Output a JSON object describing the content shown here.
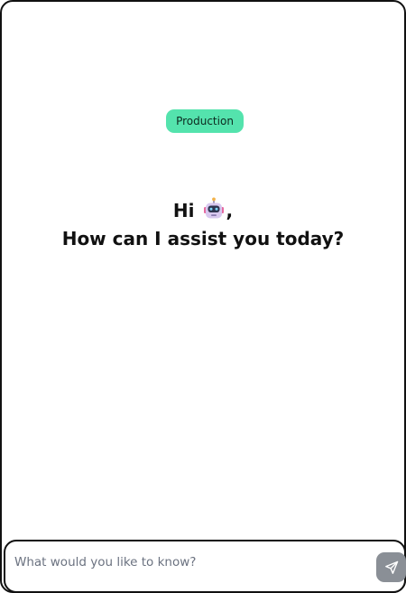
{
  "environment_badge": {
    "label": "Production",
    "color": "#54e3ad"
  },
  "greeting": {
    "prefix": "Hi",
    "suffix": ",",
    "emoji_icon": "robot-face-icon",
    "question": "How can I assist you today?"
  },
  "composer": {
    "placeholder": "What would you like to know?",
    "value": "",
    "send_icon": "send-icon",
    "send_button_color": "#8a8f96"
  }
}
